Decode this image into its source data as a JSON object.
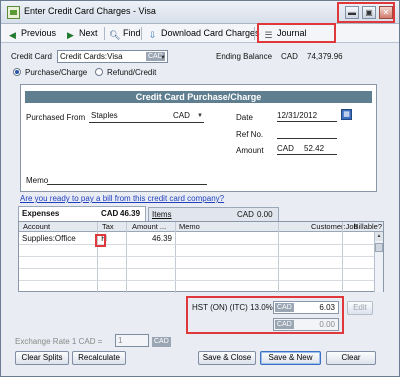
{
  "window": {
    "title": "Enter Credit Card Charges - Visa",
    "minimize": "▬",
    "restore": "▣",
    "close": "✕"
  },
  "toolbar": {
    "previous": "Previous",
    "next": "Next",
    "find": "Find",
    "download": "Download Card Charges",
    "journal": "Journal"
  },
  "header": {
    "credit_card_label": "Credit Card",
    "credit_card_value": "Credit Cards:Visa",
    "credit_card_currency": "CAD",
    "ending_balance_label": "Ending Balance",
    "ending_balance_currency": "CAD",
    "ending_balance_value": "74,379.96",
    "purchase_label": "Purchase/Charge",
    "refund_label": "Refund/Credit",
    "selected_mode": "purchase"
  },
  "form": {
    "heading": "Credit Card Purchase/Charge",
    "purchased_from_label": "Purchased From",
    "purchased_from_value": "Staples",
    "purchased_from_currency": "CAD",
    "date_label": "Date",
    "date_value": "12/31/2012",
    "ref_label": "Ref No.",
    "ref_value": "",
    "amount_label": "Amount",
    "amount_currency": "CAD",
    "amount_value": "52.42",
    "memo_label": "Memo",
    "memo_value": ""
  },
  "link": "Are you ready to pay a bill from this credit card company?",
  "tabs": {
    "expenses_label": "Expenses",
    "expenses_currency": "CAD",
    "expenses_total": "46.39",
    "items_label": "Items",
    "items_currency": "CAD",
    "items_total": "0.00"
  },
  "grid": {
    "columns": [
      "Account",
      "Tax",
      "Amount ...",
      "Memo",
      "Customer:Job",
      "Billable?"
    ],
    "rows": [
      {
        "account": "Supplies:Office",
        "tax": "H",
        "amount": "46.39",
        "memo": "",
        "customer_job": "",
        "billable": ""
      }
    ]
  },
  "tax": {
    "label": "HST (ON) (ITC) 13.0%",
    "currency1": "CAD",
    "value1": "6.03",
    "edit_label": "Edit",
    "currency2": "CAD",
    "value2": "0.00"
  },
  "exchange": {
    "label": "Exchange Rate 1 CAD =",
    "value": "1",
    "currency": "CAD"
  },
  "buttons": {
    "clear_splits": "Clear Splits",
    "recalculate": "Recalculate",
    "save_close": "Save & Close",
    "save_new": "Save & New",
    "clear": "Clear"
  },
  "colors": {
    "highlight": "#e0383a",
    "form_header": "#5f7f90",
    "link": "#1f3fbf"
  }
}
